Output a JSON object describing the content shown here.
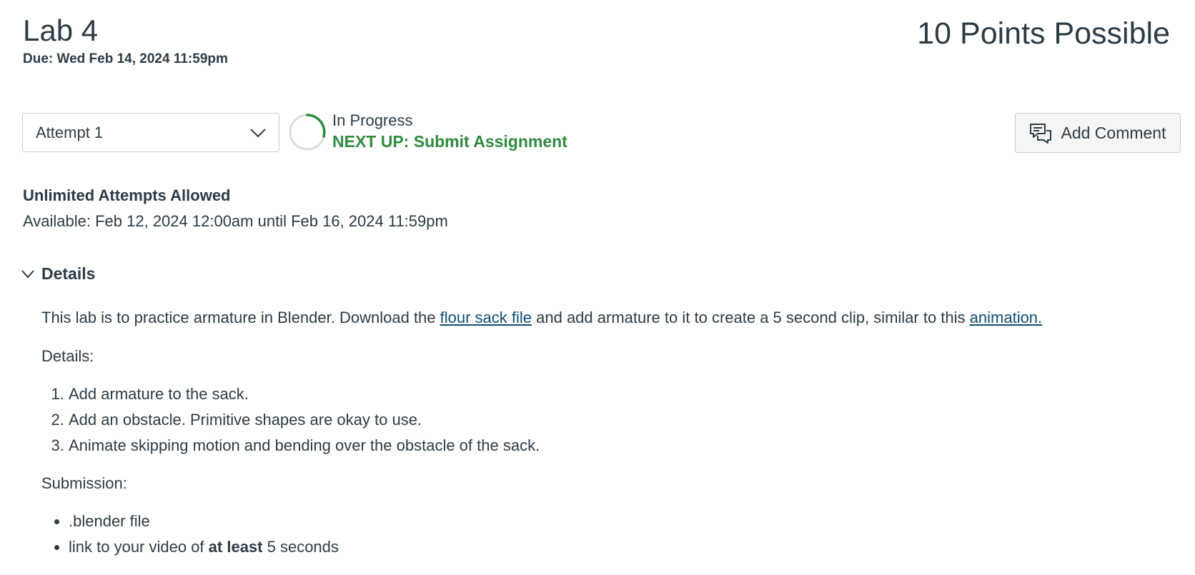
{
  "assignment": {
    "title": "Lab 4",
    "due": "Due: Wed Feb 14, 2024 11:59pm",
    "points": "10 Points Possible"
  },
  "attempt": {
    "selected": "Attempt 1"
  },
  "status": {
    "progress_label": "In Progress",
    "next_up": "NEXT UP: Submit Assignment"
  },
  "add_comment_label": "Add Comment",
  "attempts_info": {
    "unlimited": "Unlimited Attempts Allowed",
    "available": "Available: Feb 12, 2024 12:00am until Feb 16, 2024 11:59pm"
  },
  "details_toggle": "Details",
  "content": {
    "intro_before": "This lab is to practice armature in Blender.  Download the ",
    "link_flour": "flour sack file",
    "intro_middle": " and add armature to it to create a 5 second clip, similar to this ",
    "link_animation": "animation.",
    "details_heading": "Details:",
    "steps": [
      "Add armature to the sack.",
      "Add an obstacle. Primitive shapes are okay to use.",
      "Animate skipping motion and bending over the obstacle of the sack."
    ],
    "submission_heading": "Submission:",
    "submission_item1": ".blender file",
    "submission_item2_before": "link to your video of ",
    "submission_item2_bold": "at least",
    "submission_item2_after": " 5 seconds"
  },
  "colors": {
    "text": "#2d3b45",
    "success": "#2f8b3f",
    "link": "#0e4e76",
    "border": "#c7cdd1"
  },
  "icons": [
    "chevron-down-icon",
    "progress-ring-icon",
    "comment-icon",
    "chevron-down-icon"
  ]
}
